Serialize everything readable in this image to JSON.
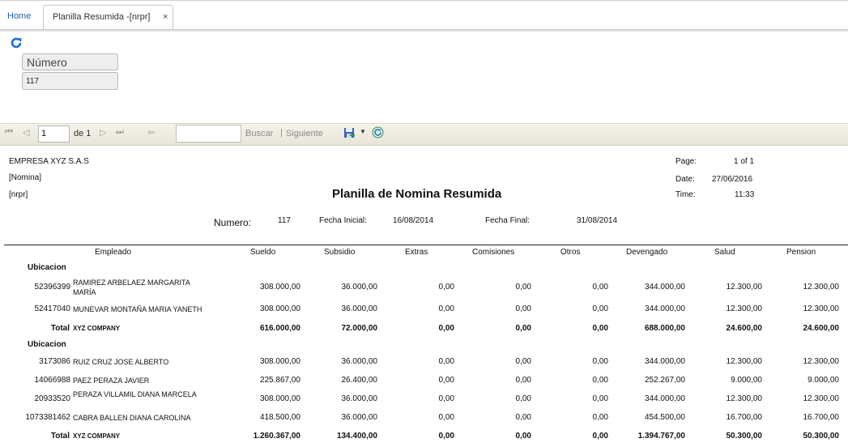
{
  "tabs": {
    "home": "Home",
    "active": "Planilla Resumida -[nrpr]",
    "close": "×"
  },
  "params": {
    "label": "Número",
    "value": "117"
  },
  "toolbar": {
    "page": "1",
    "of_label": "de 1",
    "find": "Buscar",
    "sep": "|",
    "next": "Siguiente"
  },
  "report": {
    "company": "EMPRESA XYZ S.A.S",
    "nomina": "[Nomina]",
    "code": "[nrpr]",
    "title": "Planilla de Nomina Resumida",
    "page_label": "Page:",
    "page_value": "1 of 1",
    "date_label": "Date:",
    "date_value": "27/06/2016",
    "time_label": "Time:",
    "time_value": "11:33",
    "numero_label": "Numero:",
    "numero_value": "117",
    "fi_label": "Fecha Inicial:",
    "fi_value": "16/08/2014",
    "ff_label": "Fecha Final:",
    "ff_value": "31/08/2014",
    "columns": [
      "Empleado",
      "Sueldo",
      "Subsidio",
      "Extras",
      "Comisiones",
      "Otros",
      "Devengado",
      "Salud",
      "Pension"
    ],
    "group_label": "Ubicacion",
    "total_label": "Total",
    "company_total": "XYZ COMPANY",
    "g1": [
      {
        "id": "52396399",
        "name": "RAMIREZ ARBELAEZ MARGARITA MARÍA",
        "v": [
          "308.000,00",
          "36.000,00",
          "0,00",
          "0,00",
          "0,00",
          "344.000,00",
          "12.300,00",
          "12.300,00"
        ]
      },
      {
        "id": "52417040",
        "name": "MUNEVAR MONTAÑA MARIA YANETH",
        "v": [
          "308.000,00",
          "36.000,00",
          "0,00",
          "0,00",
          "0,00",
          "344.000,00",
          "12.300,00",
          "12.300,00"
        ]
      }
    ],
    "g1_total": [
      "616.000,00",
      "72.000,00",
      "0,00",
      "0,00",
      "0,00",
      "688.000,00",
      "24.600,00",
      "24.600,00"
    ],
    "g2": [
      {
        "id": "3173086",
        "name": "RUIZ CRUZ JOSE ALBERTO",
        "v": [
          "308.000,00",
          "36.000,00",
          "0,00",
          "0,00",
          "0,00",
          "344.000,00",
          "12.300,00",
          "12.300,00"
        ]
      },
      {
        "id": "14066988",
        "name": "PAEZ PERAZA JAVIER",
        "v": [
          "225.867,00",
          "26.400,00",
          "0,00",
          "0,00",
          "0,00",
          "252.267,00",
          "9.000,00",
          "9.000,00"
        ]
      },
      {
        "id": "20933520",
        "name": "PERAZA VILLAMIL DIANA MARCELA",
        "v": [
          "308.000,00",
          "36.000,00",
          "0,00",
          "0,00",
          "0,00",
          "344.000,00",
          "12.300,00",
          "12.300,00"
        ]
      },
      {
        "id": "1073381462",
        "name": "CABRA BALLEN DIANA CAROLINA",
        "v": [
          "418.500,00",
          "36.000,00",
          "0,00",
          "0,00",
          "0,00",
          "454.500,00",
          "16.700,00",
          "16.700,00"
        ]
      }
    ],
    "g2_total": [
      "1.260.367,00",
      "134.400,00",
      "0,00",
      "0,00",
      "0,00",
      "1.394.767,00",
      "50.300,00",
      "50.300,00"
    ]
  }
}
